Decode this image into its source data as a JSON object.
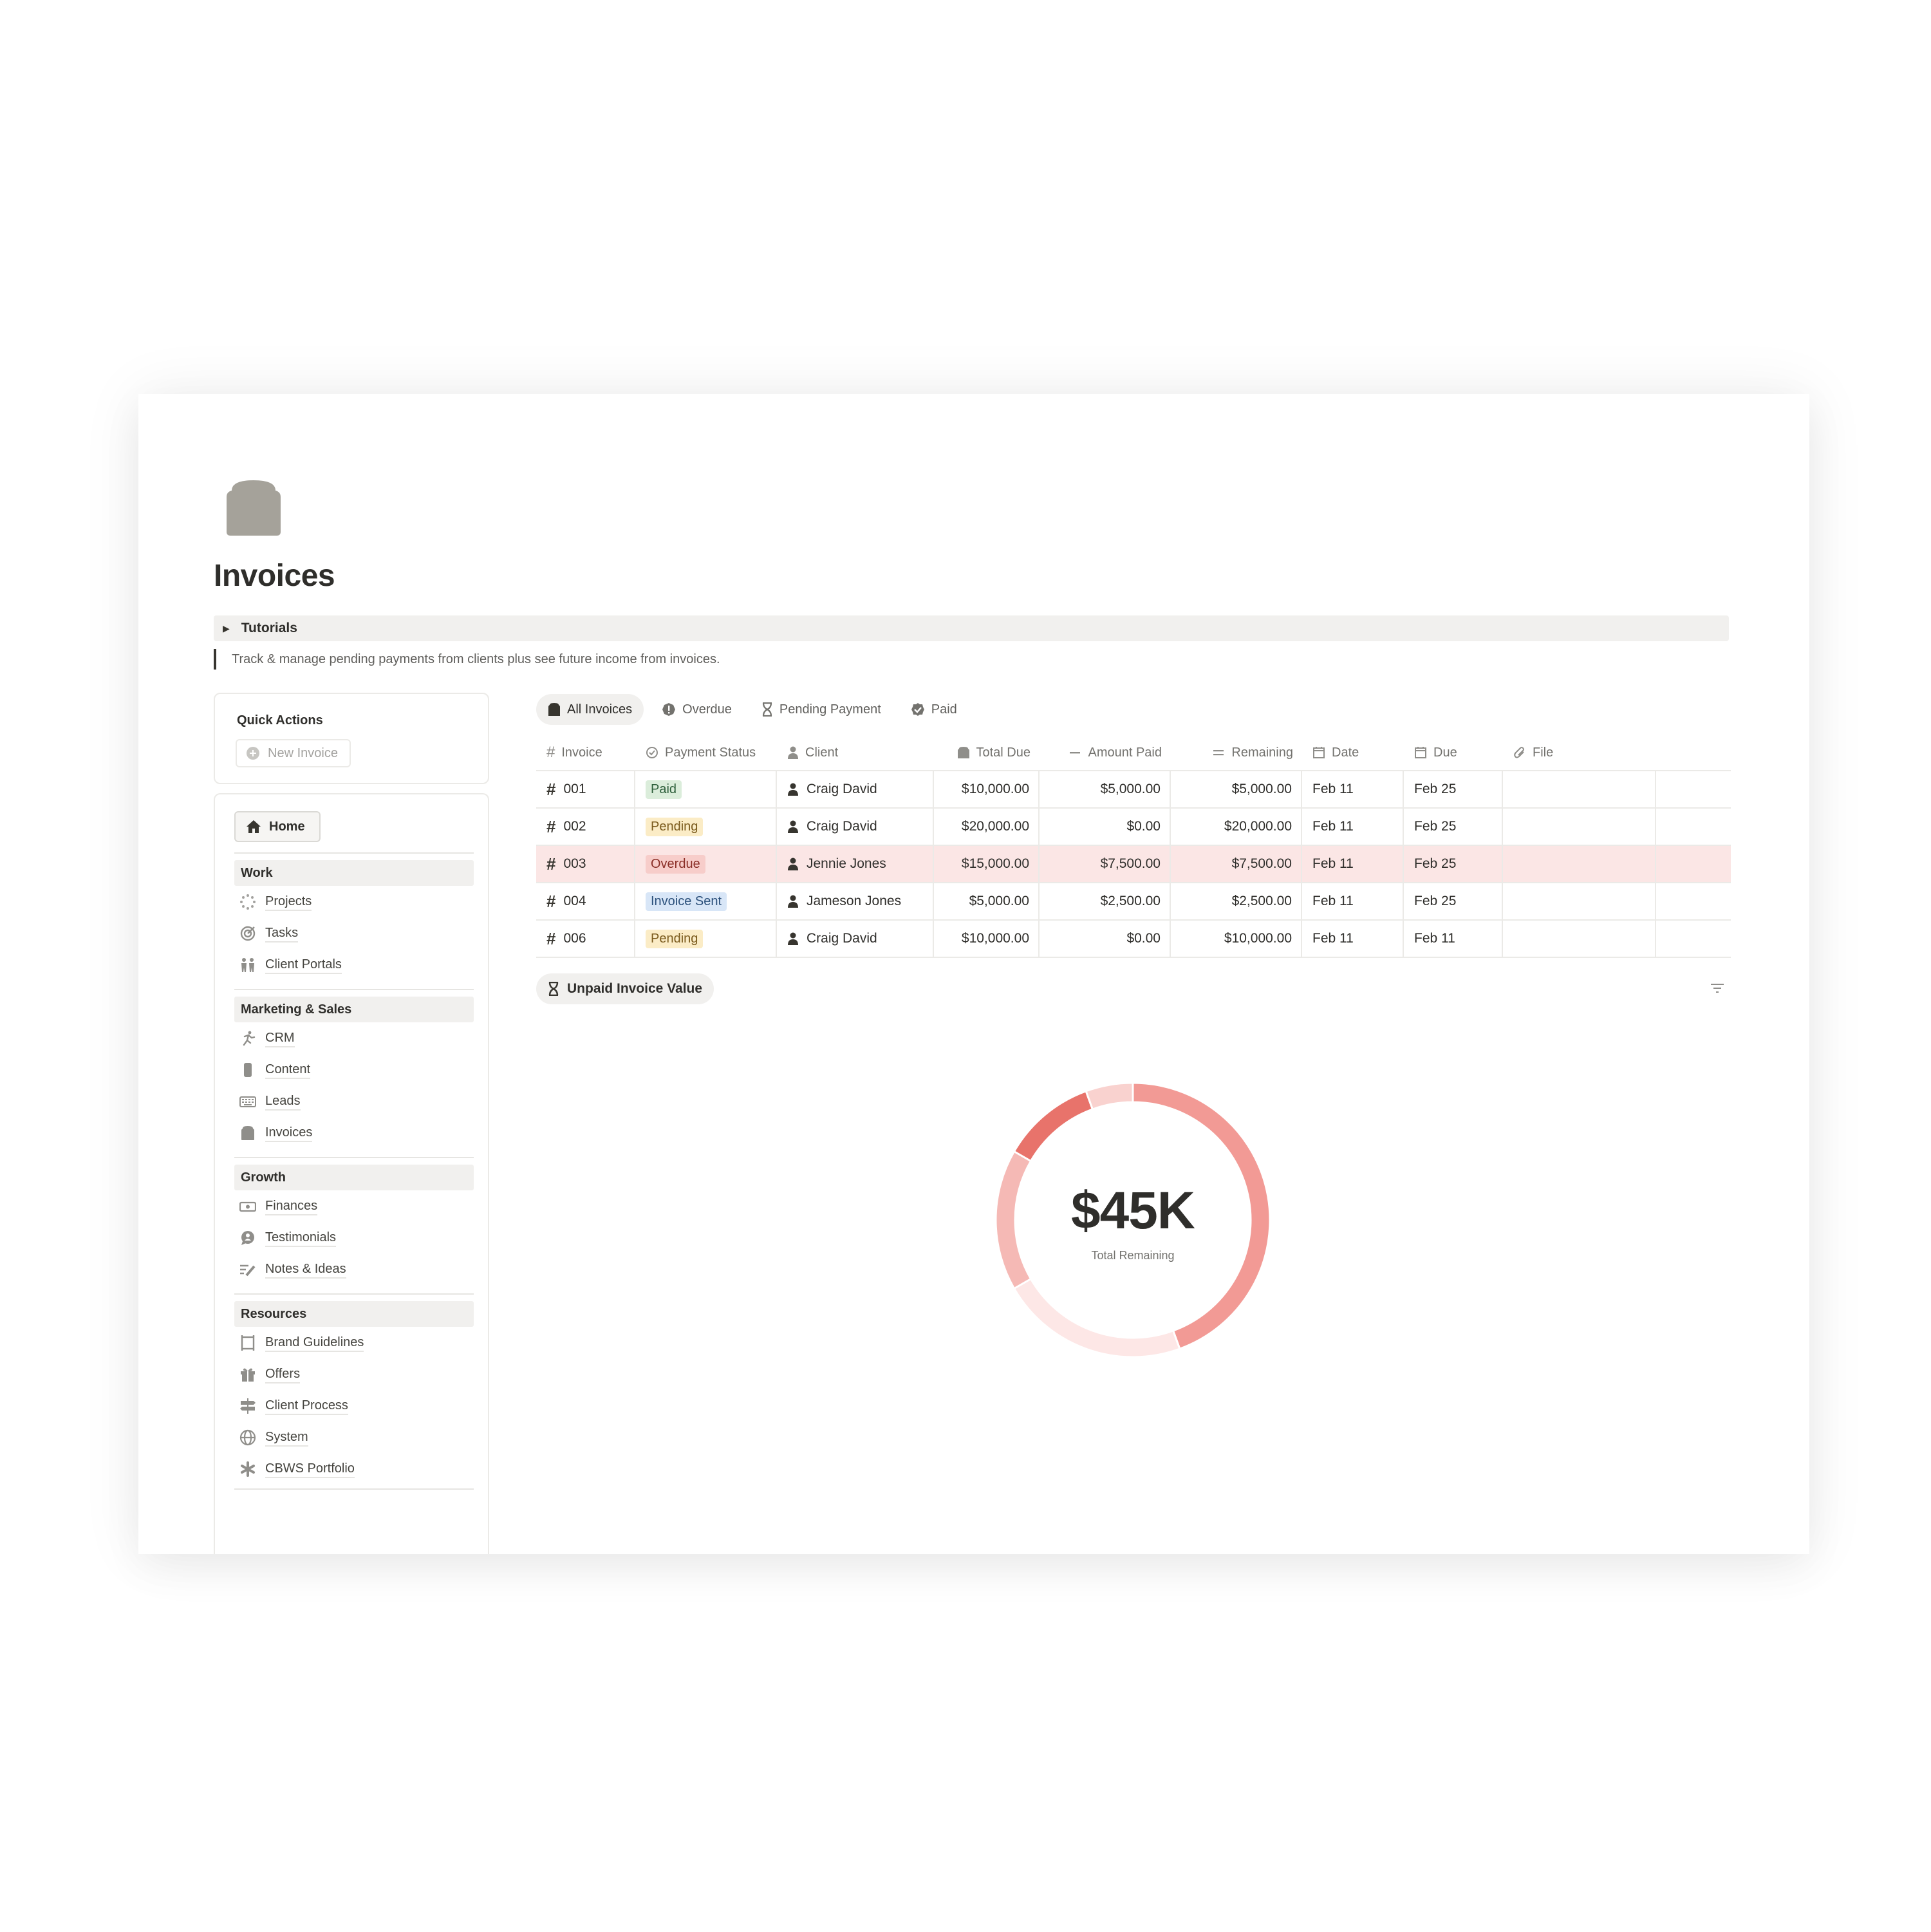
{
  "page": {
    "icon": "invoice-stack-icon",
    "title": "Invoices",
    "toggle_label": "Tutorials",
    "description": "Track & manage pending payments from clients plus see future income from invoices."
  },
  "quick_actions": {
    "title": "Quick Actions",
    "new_invoice": "New Invoice"
  },
  "sidebar": {
    "home": "Home",
    "sections": [
      {
        "title": "Work",
        "items": [
          {
            "label": "Projects",
            "icon": "loader-icon"
          },
          {
            "label": "Tasks",
            "icon": "target-icon"
          },
          {
            "label": "Client Portals",
            "icon": "people-icon"
          }
        ]
      },
      {
        "title": "Marketing & Sales",
        "items": [
          {
            "label": "CRM",
            "icon": "runner-icon"
          },
          {
            "label": "Content",
            "icon": "document-icon"
          },
          {
            "label": "Leads",
            "icon": "keyboard-icon"
          },
          {
            "label": "Invoices",
            "icon": "invoice-icon"
          }
        ]
      },
      {
        "title": "Growth",
        "items": [
          {
            "label": "Finances",
            "icon": "money-icon"
          },
          {
            "label": "Testimonials",
            "icon": "chat-icon"
          },
          {
            "label": "Notes & Ideas",
            "icon": "pencil-lines-icon"
          }
        ]
      },
      {
        "title": "Resources",
        "items": [
          {
            "label": "Brand Guidelines",
            "icon": "frame-icon"
          },
          {
            "label": "Offers",
            "icon": "gift-icon"
          },
          {
            "label": "Client Process",
            "icon": "signpost-icon"
          },
          {
            "label": "System",
            "icon": "globe-icon"
          },
          {
            "label": "CBWS Portfolio",
            "icon": "asterisk-icon"
          }
        ]
      }
    ]
  },
  "tabs": [
    {
      "label": "All Invoices",
      "icon": "invoice-icon",
      "active": true
    },
    {
      "label": "Overdue",
      "icon": "alert-icon",
      "active": false
    },
    {
      "label": "Pending Payment",
      "icon": "hourglass-icon",
      "active": false
    },
    {
      "label": "Paid",
      "icon": "check-badge-icon",
      "active": false
    }
  ],
  "table": {
    "headers": [
      "Invoice",
      "Payment Status",
      "Client",
      "Total Due",
      "Amount Paid",
      "Remaining",
      "Date",
      "Due",
      "File"
    ],
    "rows": [
      {
        "invoice": "001",
        "status": "Paid",
        "client": "Craig David",
        "total_due": "$10,000.00",
        "amount_paid": "$5,000.00",
        "remaining": "$5,000.00",
        "date": "Feb 11",
        "due": "Feb 25"
      },
      {
        "invoice": "002",
        "status": "Pending",
        "client": "Craig David",
        "total_due": "$20,000.00",
        "amount_paid": "$0.00",
        "remaining": "$20,000.00",
        "date": "Feb 11",
        "due": "Feb 25"
      },
      {
        "invoice": "003",
        "status": "Overdue",
        "client": "Jennie Jones",
        "total_due": "$15,000.00",
        "amount_paid": "$7,500.00",
        "remaining": "$7,500.00",
        "date": "Feb 11",
        "due": "Feb 25"
      },
      {
        "invoice": "004",
        "status": "Invoice Sent",
        "client": "Jameson Jones",
        "total_due": "$5,000.00",
        "amount_paid": "$2,500.00",
        "remaining": "$2,500.00",
        "date": "Feb 11",
        "due": "Feb 25"
      },
      {
        "invoice": "006",
        "status": "Pending",
        "client": "Craig David",
        "total_due": "$10,000.00",
        "amount_paid": "$0.00",
        "remaining": "$10,000.00",
        "date": "Feb 11",
        "due": "Feb 11"
      }
    ]
  },
  "status_colors": {
    "Paid": {
      "bg": "#dbeddb",
      "fg": "#2d5e3a"
    },
    "Pending": {
      "bg": "#fbecc6",
      "fg": "#7a5a1c"
    },
    "Overdue": {
      "bg": "#f7cdca",
      "fg": "#8a2e27"
    },
    "Invoice Sent": {
      "bg": "#d8e6f7",
      "fg": "#2a4f7a"
    }
  },
  "chart_data": {
    "type": "pie",
    "title": "Unpaid Invoice Value",
    "center_value": "$45K",
    "center_label": "Total Remaining",
    "slices": [
      {
        "value": 20000,
        "color": "#f29a95"
      },
      {
        "value": 10000,
        "color": "#fde7e6"
      },
      {
        "value": 7500,
        "color": "#f5b9b5"
      },
      {
        "value": 5000,
        "color": "#e8736b"
      },
      {
        "value": 2500,
        "color": "#f9d2cf"
      }
    ]
  }
}
